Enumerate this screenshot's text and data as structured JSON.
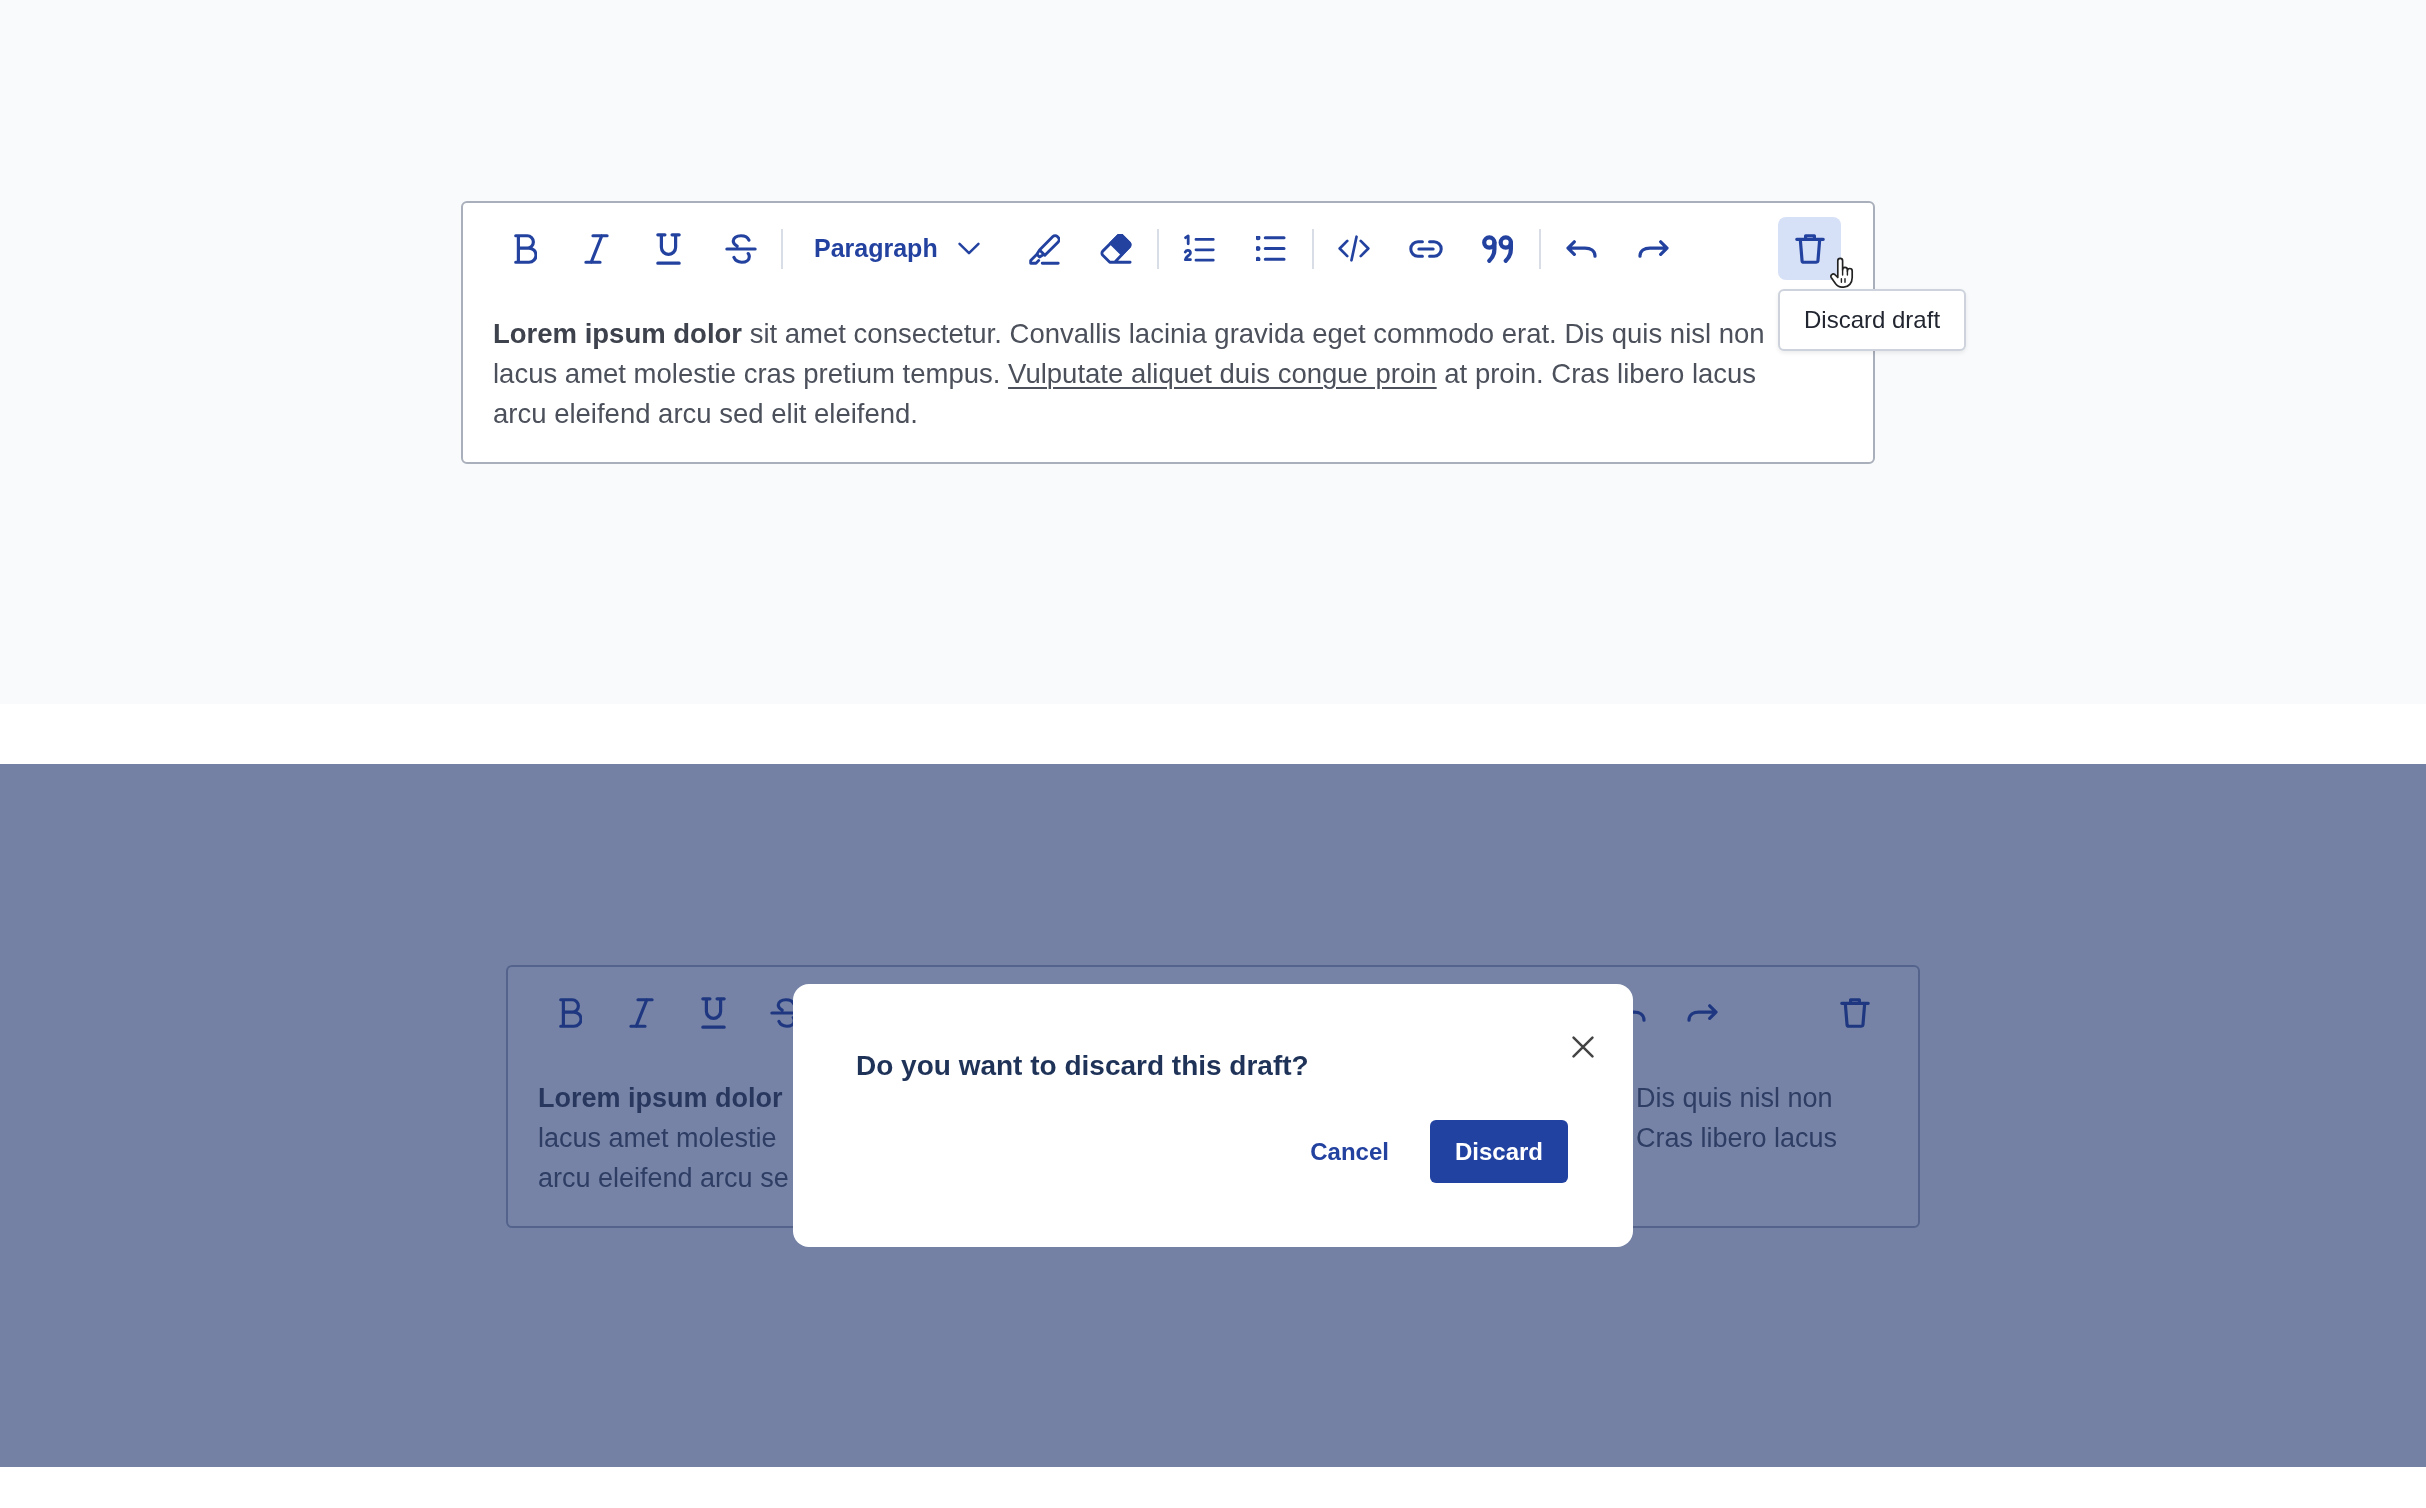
{
  "editor": {
    "toolbar": {
      "block_format": "Paragraph",
      "discard_button": {
        "hovered": true,
        "tooltip": "Discard draft"
      }
    },
    "content": [
      {
        "text": "Lorem ipsum dolor",
        "bold": true,
        "underlined": false
      },
      {
        "text": " sit amet consectetur. Convallis lacinia gravida eget commodo erat. Dis quis nisl non lacus amet molestie cras pretium tempus. ",
        "bold": false,
        "underlined": false
      },
      {
        "text": "Vulputate aliquet duis congue proin",
        "bold": false,
        "underlined": true
      },
      {
        "text": " at proin. Cras libero lacus arcu eleifend arcu sed elit eleifend.",
        "bold": false,
        "underlined": false
      }
    ]
  },
  "discard_confirmation": {
    "background_editor": {
      "toolbar": {
        "discard_button": {
          "hovered": false
        }
      },
      "visible_text_left": [
        {
          "text": "Lorem ipsum dolor",
          "bold": true
        },
        {
          "text": "lacus amet molestie",
          "bold": false
        },
        {
          "text": "arcu eleifend arcu se",
          "bold": false
        }
      ],
      "visible_text_right": [
        {
          "text": "Dis quis nisl non",
          "bold": false
        },
        {
          "text": "Cras libero lacus",
          "bold": false
        }
      ]
    },
    "dialog": {
      "title": "Do you want to discard this draft?",
      "actions": [
        {
          "label": "Cancel",
          "kind": "text"
        },
        {
          "label": "Discard",
          "kind": "primary"
        }
      ]
    }
  }
}
